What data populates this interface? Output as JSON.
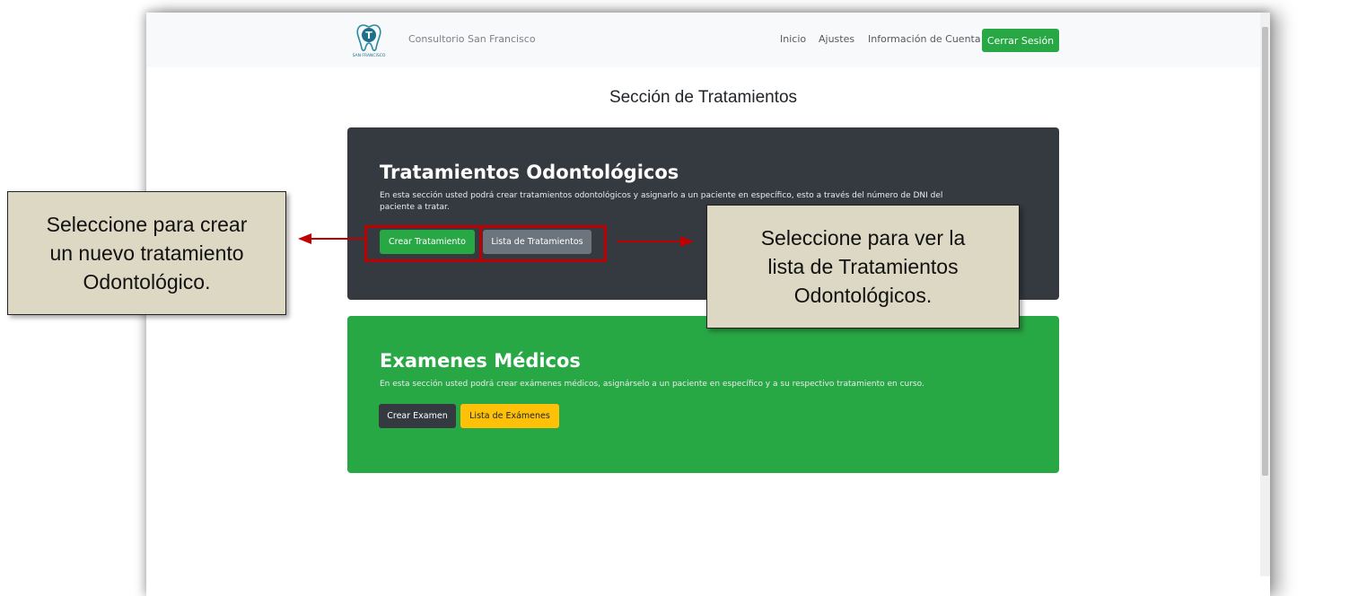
{
  "navbar": {
    "brand": "Consultorio San Francisco",
    "logo_text": "SAN FRANCISCO",
    "links": [
      "Inicio",
      "Ajustes",
      "Información de Cuenta"
    ],
    "logout": "Cerrar Sesión"
  },
  "page_title": "Sección de Tratamientos",
  "treatments": {
    "title": "Tratamientos Odontológicos",
    "description_1": "En esta sección usted podrá crear tratamientos odontológicos y asignarlo a un paciente en específico, esto a través del número de DNI del",
    "description_2": "paciente a tratar.",
    "create_button": "Crear Tratamiento",
    "list_button": "Lista de Tratamientos"
  },
  "exams": {
    "title": "Examenes Médicos",
    "description": "En esta sección usted podrá crear exámenes médicos, asignárselo a un paciente en específico y a su respectivo tratamiento en curso.",
    "create_button": "Crear Examen",
    "list_button": "Lista de Exámenes"
  },
  "callouts": {
    "left": [
      "Seleccione para crear",
      "un nuevo tratamiento",
      "Odontológico."
    ],
    "right": [
      "Seleccione para ver la",
      "lista de Tratamientos",
      "Odontológicos."
    ]
  },
  "colors": {
    "dark_card": "#343a40",
    "green": "#28a745",
    "yellow": "#ffc107",
    "secondary": "#6c757d",
    "highlight": "#c00000",
    "callout_bg": "#ddd8c4"
  }
}
